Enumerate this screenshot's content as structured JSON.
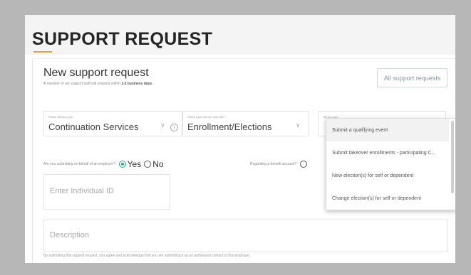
{
  "page": {
    "title": "SUPPORT REQUEST",
    "accent_color": "#e0a33a"
  },
  "card": {
    "title": "New support request",
    "subtitle_prefix": "A member of our support staff will respond within",
    "subtitle_bold": "1-2 business days",
    "subtitle_suffix": ".",
    "all_requests_button": "All support requests"
  },
  "fields": {
    "offering_type": {
      "label": "Select offering type",
      "value": "Continuation Services"
    },
    "help_with": {
      "label": "Which topic can we help with?",
      "value": "Enrollment/Elections"
    },
    "tell_more": {
      "label": "Tell us more"
    },
    "employer_question": {
      "text": "Are you submitting on behalf of an employer?",
      "yes": "Yes",
      "no": "No",
      "selected": "yes"
    },
    "benefit_question": {
      "text": "Regarding a benefit account?"
    },
    "individual_id": {
      "placeholder": "Enter Individual ID"
    },
    "description": {
      "placeholder": "Description"
    }
  },
  "dropdown": {
    "options": [
      "Submit a qualifying event",
      "Submit takeover enrollments - participating C...",
      "New election(s) for self or dependent",
      "Change election(s) for self or dependent"
    ]
  },
  "disclaimer": "By submitting this support request, you agree and acknowledge that you are submitting it as an authorized contact of this employer.",
  "colors": {
    "radio_selected": "#1aa88a",
    "background": "#b7b7b7"
  }
}
